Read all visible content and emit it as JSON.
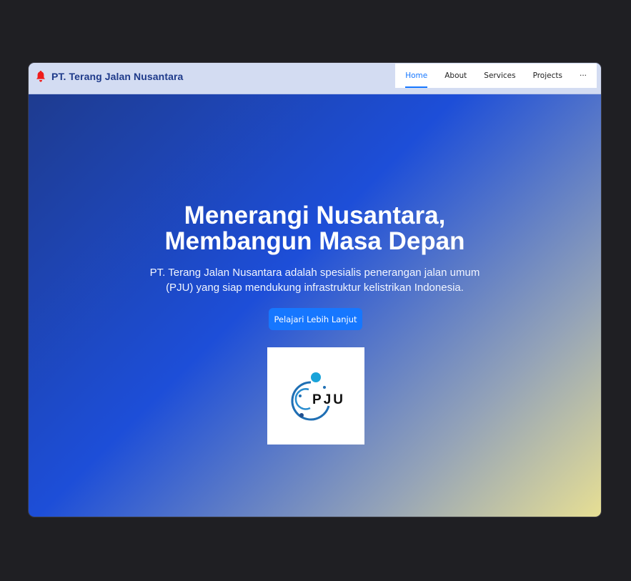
{
  "navbar": {
    "brand_name": "PT. Terang Jalan Nusantara",
    "brand_icon": "bell-icon",
    "brand_icon_color": "#ef1c1c",
    "items": [
      {
        "label": "Home",
        "active": true
      },
      {
        "label": "About"
      },
      {
        "label": "Services"
      },
      {
        "label": "Projects"
      },
      {
        "label": "···"
      }
    ],
    "active_color": "#1677ff"
  },
  "hero": {
    "title_line1": "Menerangi Nusantara,",
    "title_line2": "Membangun Masa Depan",
    "description": "PT. Terang Jalan Nusantara adalah spesialis penerangan jalan umum (PJU) yang siap mendukung infrastruktur kelistrikan Indonesia.",
    "button_label": "Pelajari Lebih Lanjut",
    "logo_text": "PJU"
  },
  "colors": {
    "gradient_start": "#1e3a8a",
    "gradient_mid": "#1d4ed8",
    "gradient_end": "#e7df94",
    "button": "#1677ff"
  }
}
